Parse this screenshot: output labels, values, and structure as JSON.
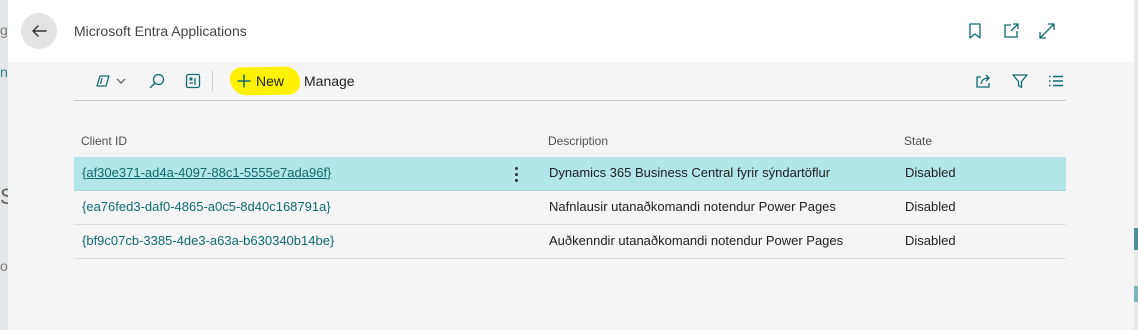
{
  "window": {
    "title": "Microsoft Entra Applications"
  },
  "header_actions": [
    {
      "name": "bookmark-icon"
    },
    {
      "name": "open-new-window-icon"
    },
    {
      "name": "expand-icon"
    }
  ],
  "toolbar": {
    "new_label": "New",
    "manage_label": "Manage"
  },
  "table": {
    "columns": [
      "Client ID",
      "Description",
      "State"
    ],
    "rows": [
      {
        "client_id": "{af30e371-ad4a-4097-88c1-5555e7ada96f}",
        "description": "Dynamics 365 Business Central fyrir sýndartöflur",
        "state": "Disabled",
        "selected": true
      },
      {
        "client_id": "{ea76fed3-daf0-4865-a0c5-8d40c168791a}",
        "description": "Nafnlausir utanaðkomandi notendur Power Pages",
        "state": "Disabled",
        "selected": false
      },
      {
        "client_id": "{bf9c07cb-3385-4de3-a63a-b630340b14be}",
        "description": "Auðkenndir utanaðkomandi notendur Power Pages",
        "state": "Disabled",
        "selected": false
      }
    ]
  },
  "colors": {
    "accent_link": "#0e6b6f",
    "selected_row": "#b3e6e8",
    "highlight": "#fff200"
  }
}
